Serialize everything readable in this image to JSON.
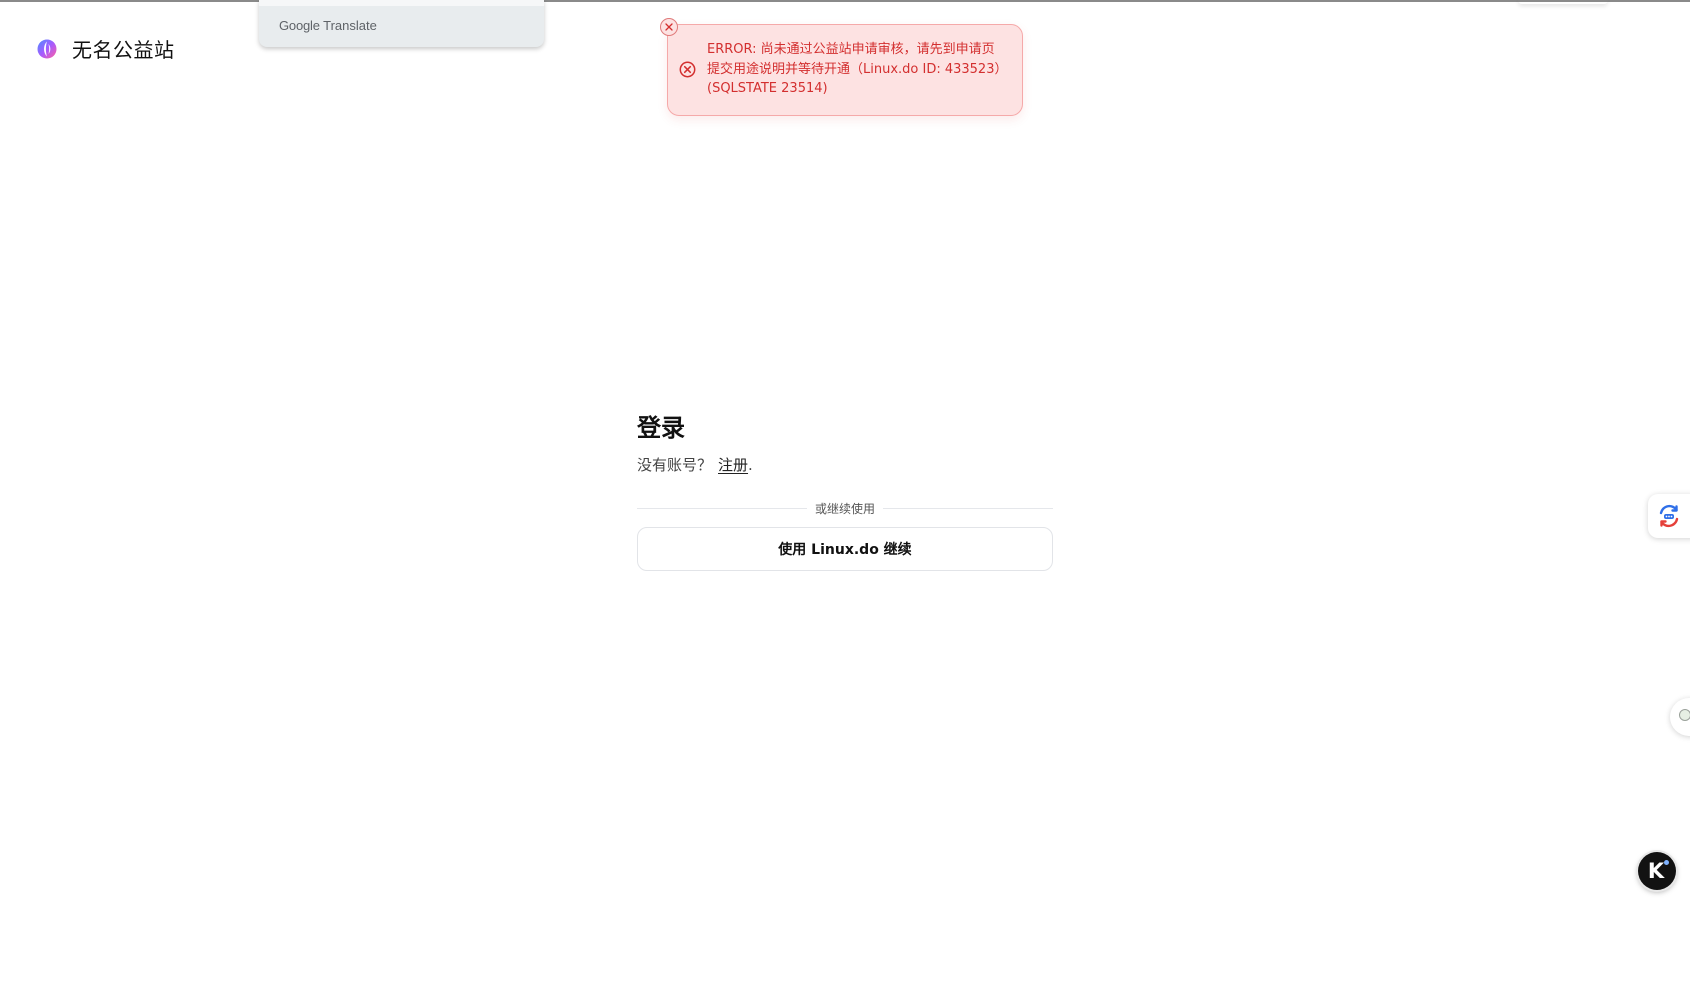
{
  "header": {
    "site_name": "无名公益站"
  },
  "translate_panel": {
    "brand": "Google",
    "product": "Translate"
  },
  "toast": {
    "type": "error",
    "message": "ERROR: 尚未通过公益站申请审核，请先到申请页提交用途说明并等待开通（Linux.do ID: 433523）(SQLSTATE 23514)",
    "close_icon": "close-icon",
    "status_icon": "error-circle-x-icon",
    "color_text": "#d32f2f",
    "color_background": "#fde2e2"
  },
  "login": {
    "title": "登录",
    "no_account_text": "没有账号？",
    "register_link": "注册",
    "register_suffix": ".",
    "divider_text": "或继续使用",
    "linuxdo_button": "使用 Linux.do 继续"
  },
  "widgets": {
    "translate_float_icon": "translate-icon",
    "bubble_icon": "assistant-bubble-icon",
    "k_button_letter": "K"
  }
}
